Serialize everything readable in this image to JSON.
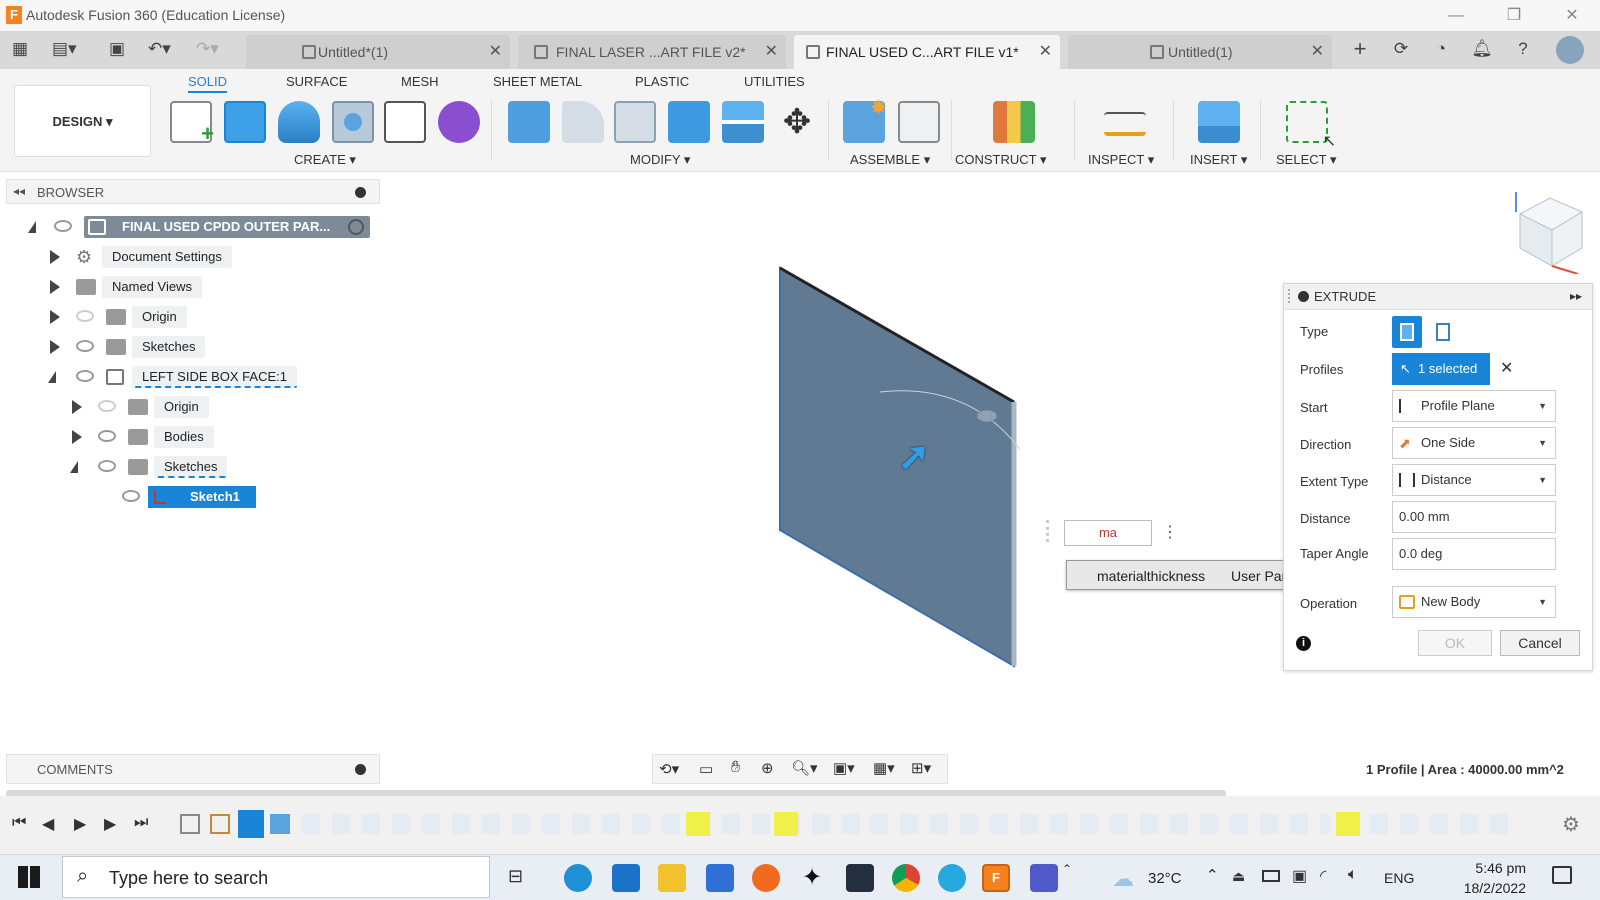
{
  "window": {
    "title": "Autodesk Fusion 360 (Education License)",
    "logo_letter": "F",
    "minimize": "—",
    "restore": "❐",
    "close": "✕"
  },
  "tabs": [
    {
      "label": "Untitled*(1)",
      "active": false
    },
    {
      "label": "FINAL LASER ...ART FILE v2*",
      "active": false
    },
    {
      "label": "FINAL USED C...ART FILE v1*",
      "active": true
    },
    {
      "label": "Untitled(1)",
      "active": false
    }
  ],
  "toolbar": {
    "design_label": "DESIGN ▾",
    "tabs": [
      "SOLID",
      "SURFACE",
      "MESH",
      "SHEET METAL",
      "PLASTIC",
      "UTILITIES"
    ],
    "groups": {
      "create": "CREATE ▾",
      "modify": "MODIFY ▾",
      "assemble": "ASSEMBLE ▾",
      "construct": "CONSTRUCT ▾",
      "inspect": "INSPECT ▾",
      "insert": "INSERT ▾",
      "select": "SELECT ▾"
    }
  },
  "browser": {
    "title": "BROWSER",
    "root": "FINAL USED CPDD OUTER PAR...",
    "items": {
      "document_settings": "Document Settings",
      "named_views": "Named Views",
      "origin": "Origin",
      "sketches": "Sketches",
      "component": "LEFT SIDE BOX FACE:1",
      "comp_origin": "Origin",
      "comp_bodies": "Bodies",
      "comp_sketches": "Sketches",
      "sketch1": "Sketch1"
    }
  },
  "viewport": {
    "input_value": "ma",
    "autocomplete_name": "materialthickness",
    "autocomplete_type": "User Parameter (mm)"
  },
  "extrude": {
    "title": "EXTRUDE",
    "type_label": "Type",
    "profiles_label": "Profiles",
    "profiles_value": "1 selected",
    "start_label": "Start",
    "start_value": "Profile Plane",
    "direction_label": "Direction",
    "direction_value": "One Side",
    "extent_label": "Extent Type",
    "extent_value": "Distance",
    "distance_label": "Distance",
    "distance_value": "0.00 mm",
    "taper_label": "Taper Angle",
    "taper_value": "0.0 deg",
    "operation_label": "Operation",
    "operation_value": "New Body",
    "ok": "OK",
    "cancel": "Cancel"
  },
  "status": {
    "comments": "COMMENTS",
    "profile_info": "1 Profile | Area : 40000.00 mm^2"
  },
  "taskbar": {
    "search_placeholder": "Type here to search",
    "weather": "32°C",
    "language": "ENG",
    "time": "5:46 pm",
    "date": "18/2/2022"
  },
  "colors": {
    "accent": "#1a85d6",
    "plate": "#607a94",
    "fusion_orange": "#f58220"
  }
}
